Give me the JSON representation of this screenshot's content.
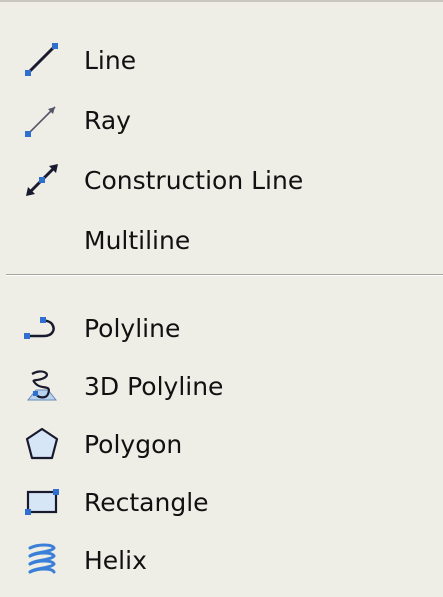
{
  "menu": {
    "items": [
      {
        "label": "Line",
        "icon": "line-icon"
      },
      {
        "label": "Ray",
        "icon": "ray-icon"
      },
      {
        "label": "Construction Line",
        "icon": "construction-line-icon"
      },
      {
        "label": "Multiline",
        "icon": ""
      },
      {
        "label": "Polyline",
        "icon": "polyline-icon"
      },
      {
        "label": "3D Polyline",
        "icon": "3d-polyline-icon"
      },
      {
        "label": "Polygon",
        "icon": "polygon-icon"
      },
      {
        "label": "Rectangle",
        "icon": "rectangle-icon"
      },
      {
        "label": "Helix",
        "icon": "helix-icon"
      }
    ]
  },
  "colors": {
    "background": "#eeede6",
    "icon_dark": "#1a1a2e",
    "icon_blue": "#2f6fd0",
    "separator": "#a8a69c"
  }
}
